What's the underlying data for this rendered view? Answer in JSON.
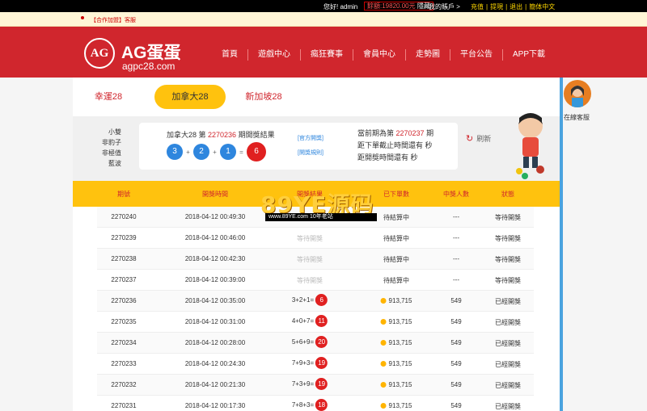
{
  "topbar": {
    "greeting": "您好! admin",
    "balance": "餘額:19820.00元",
    "balance_hide": "隱藏",
    "account": "我的賬戶 >",
    "links": [
      "充值",
      "|",
      "提現",
      "|",
      "退出",
      "|",
      "簡体中文"
    ]
  },
  "notice": {
    "text": "【合作加盟】客服"
  },
  "header": {
    "logo_mark": "AG",
    "logo_name": "AG蛋蛋",
    "logo_url": "agpc28.com",
    "nav": [
      "首頁",
      "遊戲中心",
      "瘋狂賽事",
      "會員中心",
      "走勢圖",
      "平台公告",
      "APP下載"
    ]
  },
  "tabs": [
    "幸運28",
    "加拿大28",
    "新加坡28"
  ],
  "side_labels": [
    "小雙",
    "非豹子",
    "非極值",
    "藍波"
  ],
  "result": {
    "title_prefix": "加拿大28 第 ",
    "issue": "2270236",
    "title_suffix": " 期開獎結果",
    "balls": [
      "3",
      "2",
      "1"
    ],
    "ops": [
      "+",
      "+",
      "="
    ],
    "sum": "6",
    "link_official": "[官方開獎]",
    "link_rules": "[開獎規則]",
    "next_prefix": "當前期為第 ",
    "next_issue": "2270237",
    "next_suffix": " 期",
    "close_countdown": "距下單截止時間還有 秒",
    "draw_countdown": "距開獎時間還有 秒",
    "refresh": "刷新"
  },
  "table": {
    "headers": [
      "期號",
      "開獎時間",
      "開獎結果",
      "已下單數",
      "中獎人數",
      "狀態"
    ],
    "rows": [
      {
        "issue": "2270240",
        "time": "2018-04-12 00:49:30",
        "result": "",
        "sum": "",
        "orders": "待結算中",
        "winners": "---",
        "status": "等待開獎",
        "pending": true
      },
      {
        "issue": "2270239",
        "time": "2018-04-12 00:46:00",
        "result": "等待開獎",
        "sum": "",
        "orders": "待結算中",
        "winners": "---",
        "status": "等待開獎",
        "pending": true
      },
      {
        "issue": "2270238",
        "time": "2018-04-12 00:42:30",
        "result": "等待開獎",
        "sum": "",
        "orders": "待結算中",
        "winners": "---",
        "status": "等待開獎",
        "pending": true
      },
      {
        "issue": "2270237",
        "time": "2018-04-12 00:39:00",
        "result": "等待開獎",
        "sum": "",
        "orders": "待結算中",
        "winners": "---",
        "status": "等待開獎",
        "pending": true
      },
      {
        "issue": "2270236",
        "time": "2018-04-12 00:35:00",
        "result": "3+2+1=",
        "sum": "6",
        "orders": "913,715",
        "winners": "549",
        "status": "已經開獎",
        "pending": false
      },
      {
        "issue": "2270235",
        "time": "2018-04-12 00:31:00",
        "result": "4+0+7=",
        "sum": "11",
        "orders": "913,715",
        "winners": "549",
        "status": "已經開獎",
        "pending": false
      },
      {
        "issue": "2270234",
        "time": "2018-04-12 00:28:00",
        "result": "5+6+9=",
        "sum": "20",
        "orders": "913,715",
        "winners": "549",
        "status": "已經開獎",
        "pending": false
      },
      {
        "issue": "2270233",
        "time": "2018-04-12 00:24:30",
        "result": "7+9+3=",
        "sum": "19",
        "orders": "913,715",
        "winners": "549",
        "status": "已經開獎",
        "pending": false
      },
      {
        "issue": "2270232",
        "time": "2018-04-12 00:21:30",
        "result": "7+3+9=",
        "sum": "19",
        "orders": "913,715",
        "winners": "549",
        "status": "已經開獎",
        "pending": false
      },
      {
        "issue": "2270231",
        "time": "2018-04-12 00:17:30",
        "result": "7+8+3=",
        "sum": "18",
        "orders": "913,715",
        "winners": "549",
        "status": "已經開獎",
        "pending": false
      }
    ]
  },
  "watermark": {
    "big": "89YE源码",
    "small": "www.89YE.com  10年老站"
  },
  "service": {
    "label": "在線客服"
  },
  "colors": {
    "brand_red": "#d0262d",
    "accent_yellow": "#ffc20e",
    "ball_blue": "#2e86de"
  }
}
